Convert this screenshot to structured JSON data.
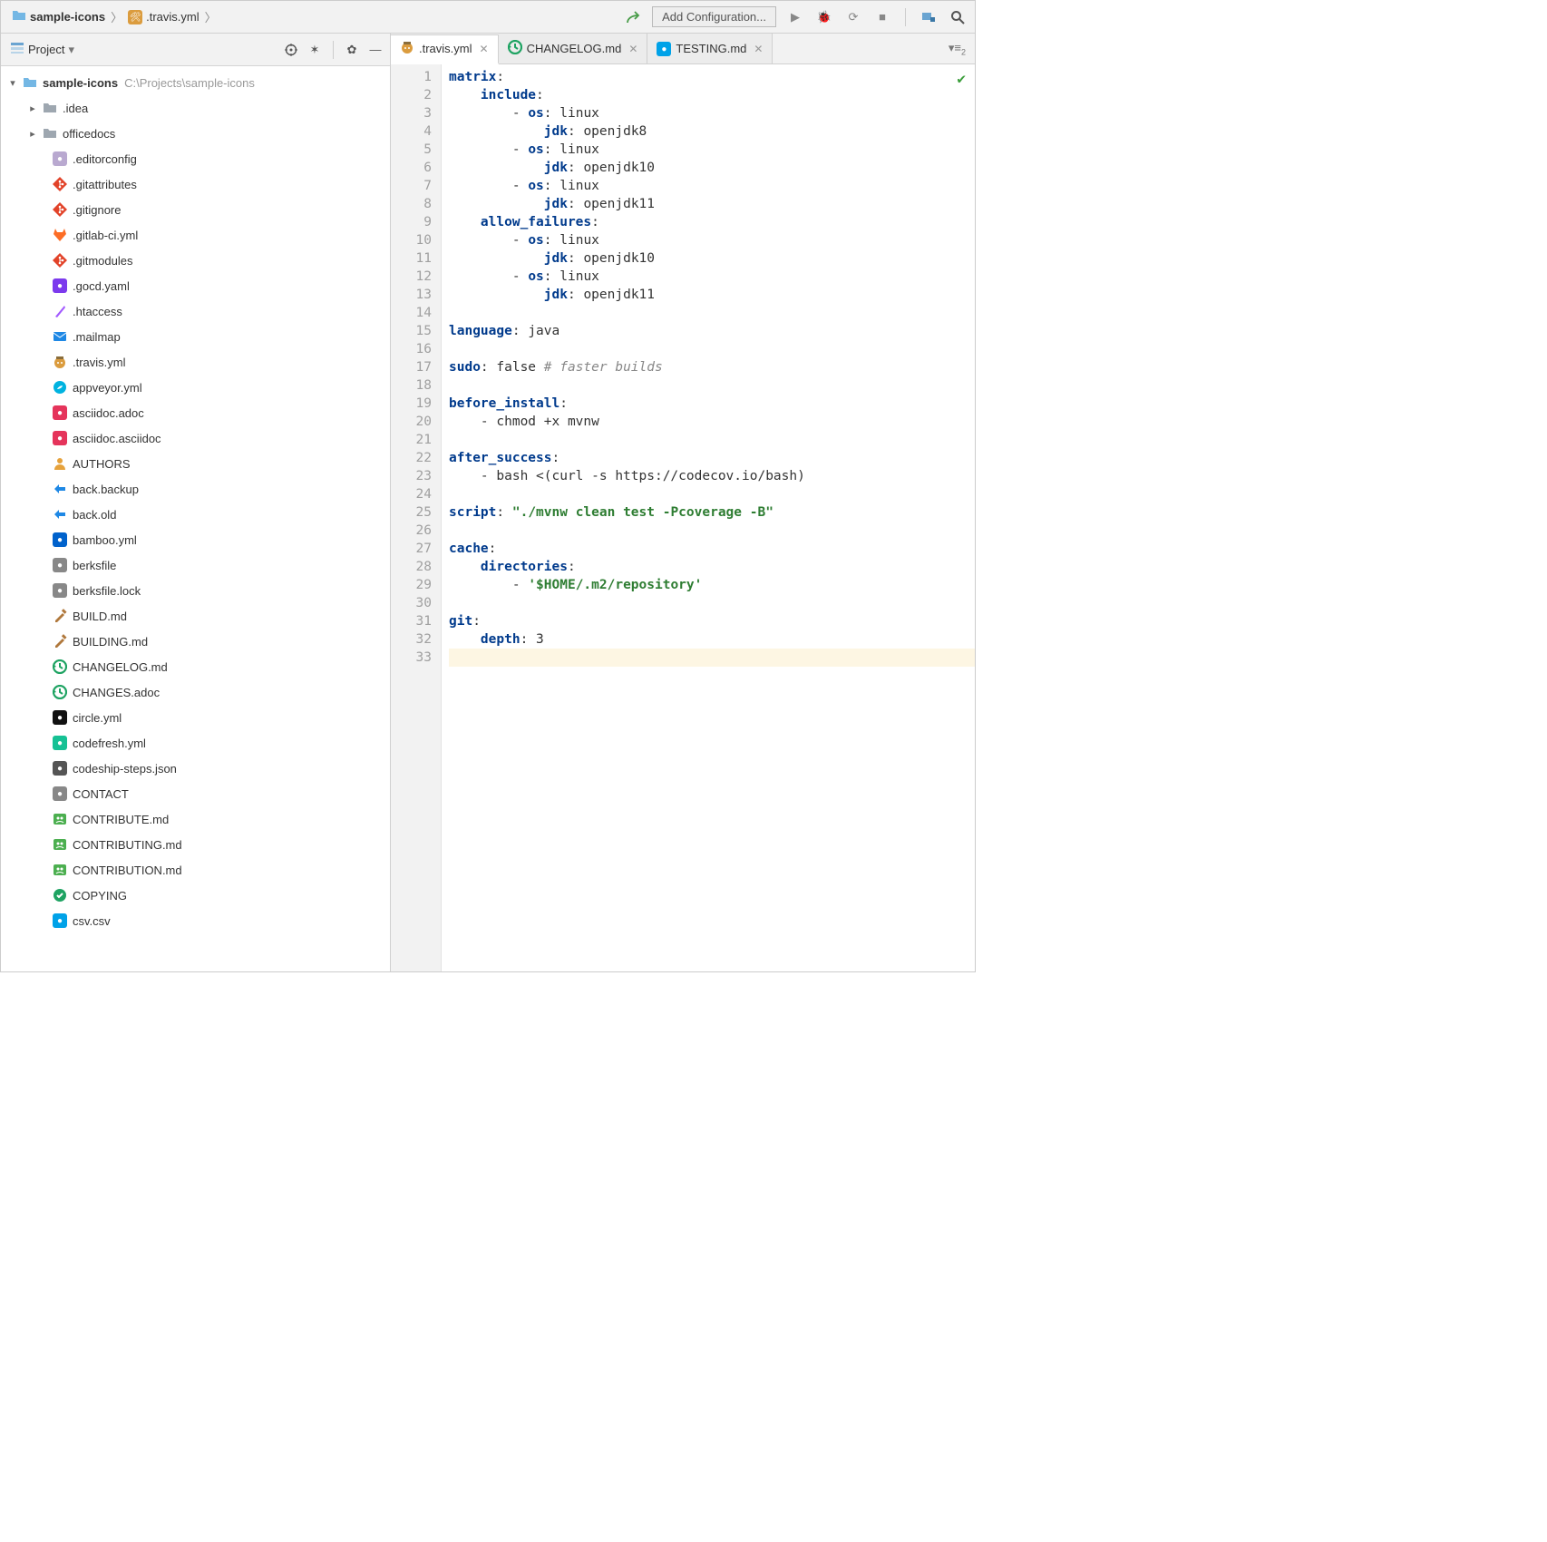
{
  "breadcrumb": {
    "crumb1": "sample-icons",
    "crumb2": ".travis.yml"
  },
  "toolbar": {
    "add_config": "Add Configuration..."
  },
  "sidebar": {
    "title": "Project",
    "root": {
      "name": "sample-icons",
      "path": "C:\\Projects\\sample-icons"
    },
    "folders": [
      {
        "name": ".idea"
      },
      {
        "name": "officedocs"
      }
    ],
    "files": [
      {
        "name": ".editorconfig",
        "icon": "editorconfig"
      },
      {
        "name": ".gitattributes",
        "icon": "git"
      },
      {
        "name": ".gitignore",
        "icon": "git"
      },
      {
        "name": ".gitlab-ci.yml",
        "icon": "gitlab"
      },
      {
        "name": ".gitmodules",
        "icon": "git"
      },
      {
        "name": ".gocd.yaml",
        "icon": "gocd"
      },
      {
        "name": ".htaccess",
        "icon": "htaccess"
      },
      {
        "name": ".mailmap",
        "icon": "mailmap"
      },
      {
        "name": ".travis.yml",
        "icon": "travis"
      },
      {
        "name": "appveyor.yml",
        "icon": "appveyor"
      },
      {
        "name": "asciidoc.adoc",
        "icon": "asciidoc"
      },
      {
        "name": "asciidoc.asciidoc",
        "icon": "asciidoc"
      },
      {
        "name": "AUTHORS",
        "icon": "authors"
      },
      {
        "name": "back.backup",
        "icon": "backup"
      },
      {
        "name": "back.old",
        "icon": "backup"
      },
      {
        "name": "bamboo.yml",
        "icon": "bamboo"
      },
      {
        "name": "berksfile",
        "icon": "berks"
      },
      {
        "name": "berksfile.lock",
        "icon": "berks"
      },
      {
        "name": "BUILD.md",
        "icon": "build"
      },
      {
        "name": "BUILDING.md",
        "icon": "build"
      },
      {
        "name": "CHANGELOG.md",
        "icon": "changelog"
      },
      {
        "name": "CHANGES.adoc",
        "icon": "changelog"
      },
      {
        "name": "circle.yml",
        "icon": "circle"
      },
      {
        "name": "codefresh.yml",
        "icon": "codefresh"
      },
      {
        "name": "codeship-steps.json",
        "icon": "codeship"
      },
      {
        "name": "CONTACT",
        "icon": "contact"
      },
      {
        "name": "CONTRIBUTE.md",
        "icon": "contribute"
      },
      {
        "name": "CONTRIBUTING.md",
        "icon": "contribute"
      },
      {
        "name": "CONTRIBUTION.md",
        "icon": "contribute"
      },
      {
        "name": "COPYING",
        "icon": "copying"
      },
      {
        "name": "csv.csv",
        "icon": "csv"
      }
    ]
  },
  "tabs": {
    "items": [
      {
        "label": ".travis.yml",
        "icon": "travis",
        "active": true
      },
      {
        "label": "CHANGELOG.md",
        "icon": "changelog",
        "active": false
      },
      {
        "label": "TESTING.md",
        "icon": "testing",
        "active": false
      }
    ]
  },
  "editor": {
    "line_count": 33,
    "lines": [
      {
        "n": 1,
        "t": "key",
        "indent": 0,
        "key": "matrix",
        "suffix": ":"
      },
      {
        "n": 2,
        "t": "key",
        "indent": 2,
        "key": "include",
        "suffix": ":"
      },
      {
        "n": 3,
        "t": "kv",
        "indent": 4,
        "prefix": "- ",
        "key": "os",
        "val": "linux"
      },
      {
        "n": 4,
        "t": "kv",
        "indent": 6,
        "prefix": "",
        "key": "jdk",
        "val": "openjdk8"
      },
      {
        "n": 5,
        "t": "kv",
        "indent": 4,
        "prefix": "- ",
        "key": "os",
        "val": "linux"
      },
      {
        "n": 6,
        "t": "kv",
        "indent": 6,
        "prefix": "",
        "key": "jdk",
        "val": "openjdk10"
      },
      {
        "n": 7,
        "t": "kv",
        "indent": 4,
        "prefix": "- ",
        "key": "os",
        "val": "linux"
      },
      {
        "n": 8,
        "t": "kv",
        "indent": 6,
        "prefix": "",
        "key": "jdk",
        "val": "openjdk11"
      },
      {
        "n": 9,
        "t": "key",
        "indent": 2,
        "key": "allow_failures",
        "suffix": ":"
      },
      {
        "n": 10,
        "t": "kv",
        "indent": 4,
        "prefix": "- ",
        "key": "os",
        "val": "linux"
      },
      {
        "n": 11,
        "t": "kv",
        "indent": 6,
        "prefix": "",
        "key": "jdk",
        "val": "openjdk10"
      },
      {
        "n": 12,
        "t": "kv",
        "indent": 4,
        "prefix": "- ",
        "key": "os",
        "val": "linux"
      },
      {
        "n": 13,
        "t": "kv",
        "indent": 6,
        "prefix": "",
        "key": "jdk",
        "val": "openjdk11"
      },
      {
        "n": 14,
        "t": "blank"
      },
      {
        "n": 15,
        "t": "kv",
        "indent": 0,
        "prefix": "",
        "key": "language",
        "val": "java"
      },
      {
        "n": 16,
        "t": "blank"
      },
      {
        "n": 17,
        "t": "kvcom",
        "indent": 0,
        "key": "sudo",
        "val": "false",
        "comment": "# faster builds"
      },
      {
        "n": 18,
        "t": "blank"
      },
      {
        "n": 19,
        "t": "key",
        "indent": 0,
        "key": "before_install",
        "suffix": ":"
      },
      {
        "n": 20,
        "t": "plain",
        "indent": 2,
        "text": "- chmod +x mvnw"
      },
      {
        "n": 21,
        "t": "blank"
      },
      {
        "n": 22,
        "t": "key",
        "indent": 0,
        "key": "after_success",
        "suffix": ":"
      },
      {
        "n": 23,
        "t": "plain",
        "indent": 2,
        "text": "- bash <(curl -s https://codecov.io/bash)"
      },
      {
        "n": 24,
        "t": "blank"
      },
      {
        "n": 25,
        "t": "kvstr",
        "indent": 0,
        "key": "script",
        "str": "\"./mvnw clean test -Pcoverage -B\""
      },
      {
        "n": 26,
        "t": "blank"
      },
      {
        "n": 27,
        "t": "key",
        "indent": 0,
        "key": "cache",
        "suffix": ":"
      },
      {
        "n": 28,
        "t": "key",
        "indent": 2,
        "key": "directories",
        "suffix": ":"
      },
      {
        "n": 29,
        "t": "strlist",
        "indent": 4,
        "prefix": "- ",
        "str": "'$HOME/.m2/repository'"
      },
      {
        "n": 30,
        "t": "blank"
      },
      {
        "n": 31,
        "t": "key",
        "indent": 0,
        "key": "git",
        "suffix": ":"
      },
      {
        "n": 32,
        "t": "kv",
        "indent": 2,
        "prefix": "",
        "key": "depth",
        "val": "3"
      },
      {
        "n": 33,
        "t": "blank",
        "current": true
      }
    ]
  },
  "icon_colors": {
    "editorconfig": "#b9a9d0",
    "git": "#e24329",
    "gitlab": "#fc6d26",
    "gocd": "#7c3aed",
    "htaccess": "#a259ff",
    "mailmap": "#1e88e5",
    "travis": "#8a6d3b",
    "appveyor": "#00b3e0",
    "asciidoc": "#e5345b",
    "authors": "#f4b400",
    "backup": "#1e88e5",
    "bamboo": "#0062cc",
    "berks": "#888",
    "build": "#b0783c",
    "changelog": "#1ea362",
    "circle": "#111",
    "codefresh": "#16c194",
    "codeship": "#555",
    "contact": "#888",
    "contribute": "#4caf50",
    "copying": "#1ea362",
    "csv": "#00a2e8",
    "testing": "#00a2e8",
    "generic": "#888"
  }
}
